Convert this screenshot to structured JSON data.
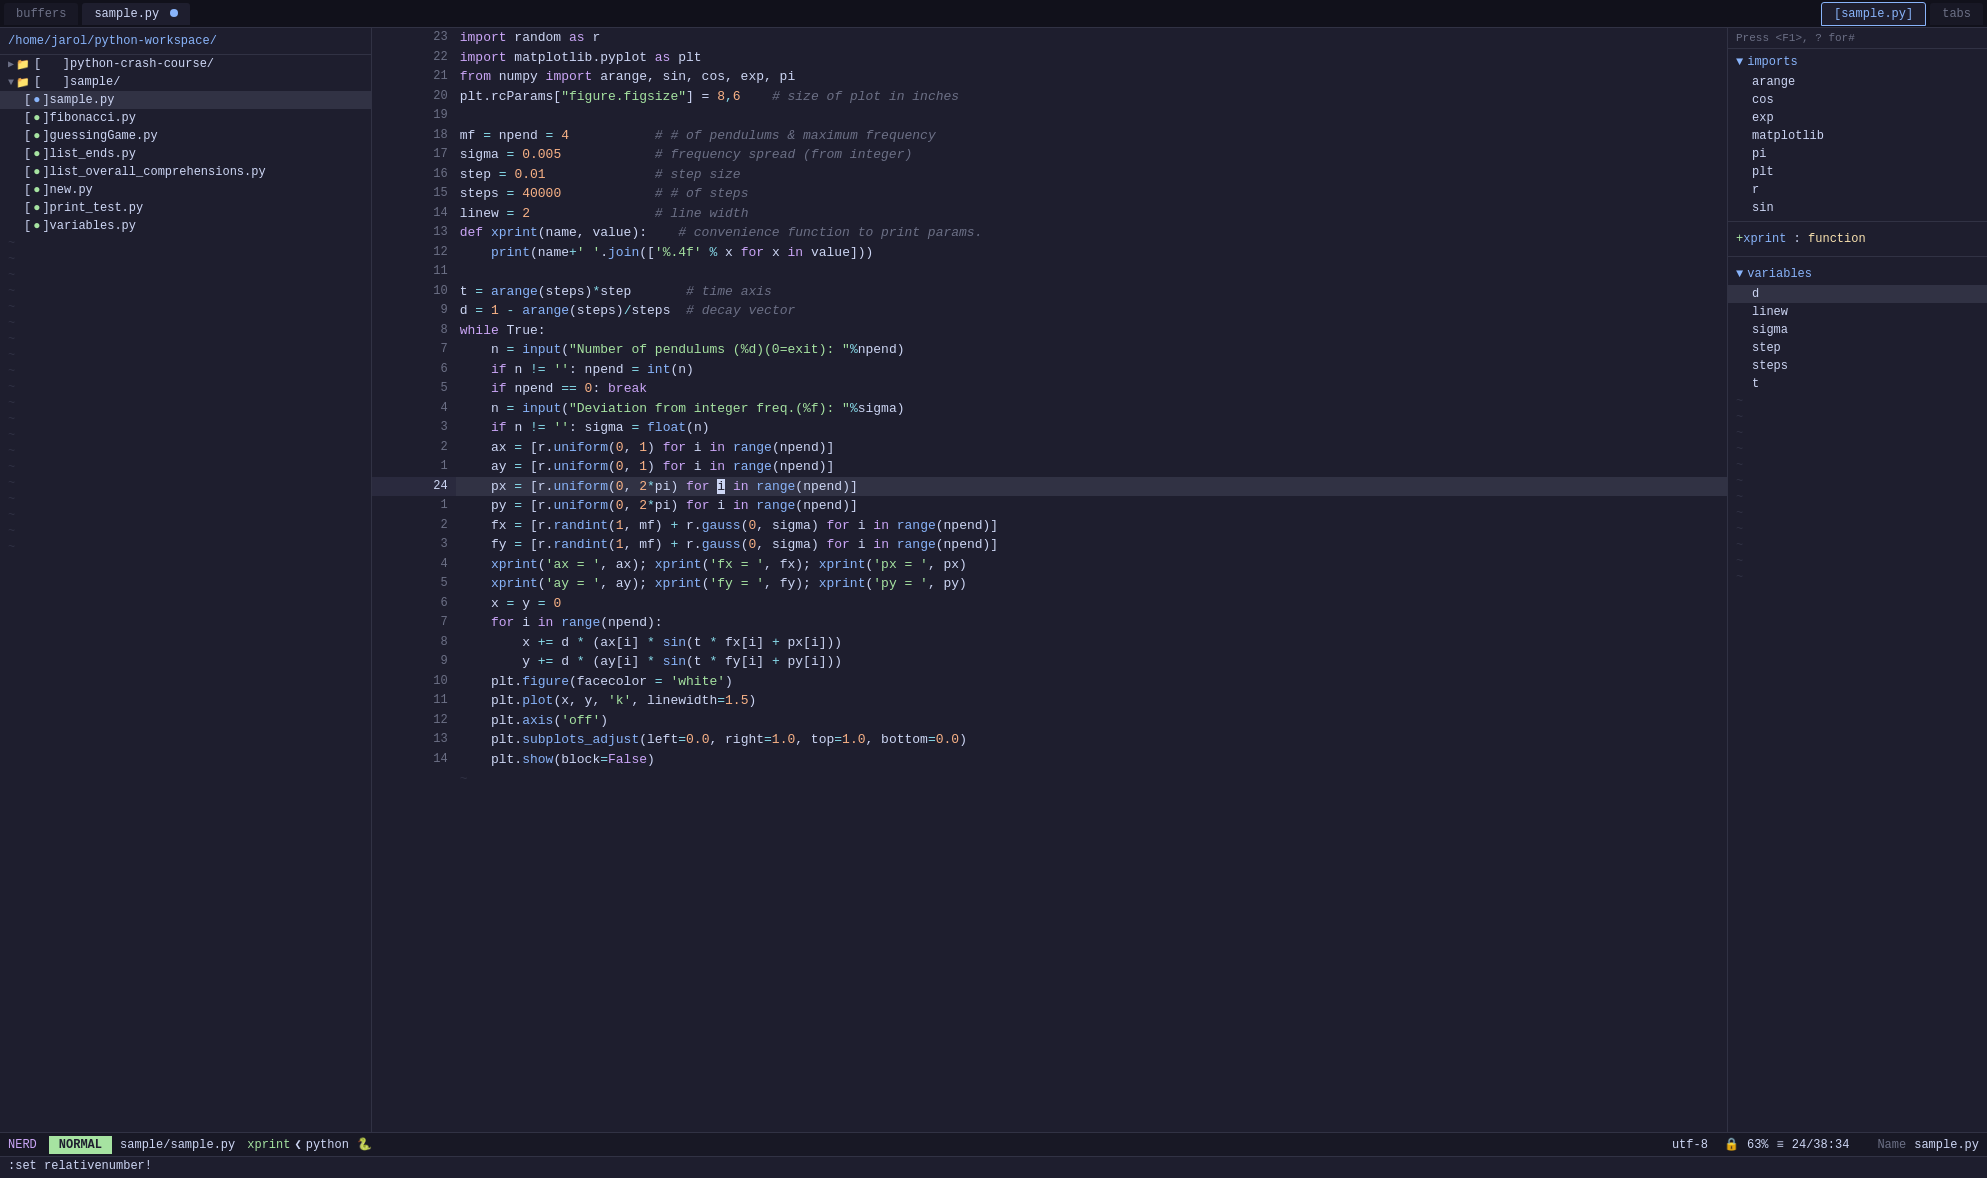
{
  "tabs": {
    "items": [
      {
        "label": "buffers",
        "active": false
      },
      {
        "label": "sample.py",
        "active": true,
        "has_dot": true
      },
      {
        "label": "tabs",
        "active": false,
        "right": true
      }
    ]
  },
  "sidebar": {
    "path": "/home/jarol/python-workspace/",
    "items": [
      {
        "indent": 0,
        "type": "chevron-open",
        "icon": "folder",
        "label": "]python-crash-course/",
        "active": false
      },
      {
        "indent": 0,
        "type": "chevron-open",
        "icon": "folder",
        "label": "]sample/",
        "active": false
      },
      {
        "indent": 1,
        "type": "file",
        "icon": "py",
        "label": "]sample.py",
        "active": true
      },
      {
        "indent": 1,
        "type": "file",
        "icon": "py",
        "label": "]fibonacci.py",
        "active": false
      },
      {
        "indent": 1,
        "type": "file",
        "icon": "py",
        "label": "]guessingGame.py",
        "active": false
      },
      {
        "indent": 1,
        "type": "file",
        "icon": "py",
        "label": "]list_ends.py",
        "active": false
      },
      {
        "indent": 1,
        "type": "file",
        "icon": "py",
        "label": "]list_overall_comprehensions.py",
        "active": false
      },
      {
        "indent": 1,
        "type": "file",
        "icon": "py",
        "label": "]new.py",
        "active": false
      },
      {
        "indent": 1,
        "type": "file",
        "icon": "py",
        "label": "]print_test.py",
        "active": false
      },
      {
        "indent": 1,
        "type": "file",
        "icon": "py",
        "label": "]variables.py",
        "active": false
      }
    ]
  },
  "editor": {
    "filename": "sample.py",
    "lines": [
      {
        "num": "23",
        "rel": "1",
        "content": "import random as r",
        "tokens": [
          {
            "t": "kw",
            "v": "import"
          },
          {
            "t": "id",
            "v": " random "
          },
          {
            "t": "kw",
            "v": "as"
          },
          {
            "t": "id",
            "v": " r"
          }
        ]
      },
      {
        "num": "22",
        "rel": "2",
        "content": "import matplotlib.pyplot as plt",
        "tokens": [
          {
            "t": "kw",
            "v": "import"
          },
          {
            "t": "id",
            "v": " matplotlib.pyplot "
          },
          {
            "t": "kw",
            "v": "as"
          },
          {
            "t": "id",
            "v": " plt"
          }
        ]
      },
      {
        "num": "21",
        "rel": "3",
        "content": "from numpy import arange, sin, cos, exp, pi",
        "tokens": [
          {
            "t": "kw",
            "v": "from"
          },
          {
            "t": "id",
            "v": " numpy "
          },
          {
            "t": "kw",
            "v": "import"
          },
          {
            "t": "id",
            "v": " arange, sin, cos, exp, pi"
          }
        ]
      },
      {
        "num": "20",
        "rel": "4",
        "content": "plt.rcParams[\"figure.figsize\"] = 8,6    # size of plot in inches"
      },
      {
        "num": "19",
        "rel": "5",
        "content": ""
      },
      {
        "num": "18",
        "rel": "6",
        "content": "mf = npend = 4           # # of pendulums & maximum frequency"
      },
      {
        "num": "17",
        "rel": "7",
        "content": "sigma = 0.005            # frequency spread (from integer)"
      },
      {
        "num": "16",
        "rel": "8",
        "content": "step = 0.01              # step size"
      },
      {
        "num": "15",
        "rel": "9",
        "content": "steps = 40000            # # of steps"
      },
      {
        "num": "14",
        "rel": "10",
        "content": "linew = 2                # line width"
      },
      {
        "num": "13",
        "rel": "11",
        "content": "def xprint(name, value):    # convenience function to print params."
      },
      {
        "num": "12",
        "rel": "12",
        "content": "    print(name+' '.join(['%.4f' % x for x in value]))"
      },
      {
        "num": "11",
        "rel": "13",
        "content": ""
      },
      {
        "num": "10",
        "rel": "14",
        "content": "t = arange(steps)*step       # time axis"
      },
      {
        "num": "9",
        "rel": "15",
        "content": "d = 1 - arange(steps)/steps  # decay vector"
      },
      {
        "num": "8",
        "rel": "16",
        "content": "while True:"
      },
      {
        "num": "7",
        "rel": "17",
        "content": "    n = input(\"Number of pendulums (%d)(0=exit): \"%npend)"
      },
      {
        "num": "6",
        "rel": "18",
        "content": "    if n != '': npend = int(n)"
      },
      {
        "num": "5",
        "rel": "19",
        "content": "    if npend == 0: break"
      },
      {
        "num": "4",
        "rel": "20",
        "content": "    n = input(\"Deviation from integer freq.(%f): \"%sigma)"
      },
      {
        "num": "3",
        "rel": "21",
        "content": "    if n != '': sigma = float(n)"
      },
      {
        "num": "2",
        "rel": "22",
        "content": "    ax = [r.uniform(0, 1) for i in range(npend)]"
      },
      {
        "num": "1",
        "rel": "23",
        "content": "    ay = [r.uniform(0, 1) for i in range(npend)]"
      },
      {
        "num": "24",
        "rel": "0",
        "content": "    px = [r.uniform(0, 2*pi) for i in range(npend)]",
        "current": true
      },
      {
        "num": "1",
        "rel": "1",
        "content": "    py = [r.uniform(0, 2*pi) for i in range(npend)]"
      },
      {
        "num": "2",
        "rel": "2",
        "content": "    fx = [r.randint(1, mf) + r.gauss(0, sigma) for i in range(npend)]"
      },
      {
        "num": "3",
        "rel": "3",
        "content": "    fy = [r.randint(1, mf) + r.gauss(0, sigma) for i in range(npend)]"
      },
      {
        "num": "4",
        "rel": "4",
        "content": "    xprint('ax = ', ax); xprint('fx = ', fx); xprint('px = ', px)"
      },
      {
        "num": "5",
        "rel": "5",
        "content": "    xprint('ay = ', ay); xprint('fy = ', fy); xprint('py = ', py)"
      },
      {
        "num": "6",
        "rel": "6",
        "content": "    x = y = 0"
      },
      {
        "num": "7",
        "rel": "7",
        "content": "    for i in range(npend):"
      },
      {
        "num": "8",
        "rel": "8",
        "content": "        x += d * (ax[i] * sin(t * fx[i] + px[i]))"
      },
      {
        "num": "9",
        "rel": "9",
        "content": "        y += d * (ay[i] * sin(t * fy[i] + py[i]))"
      },
      {
        "num": "10",
        "rel": "10",
        "content": "    plt.figure(facecolor = 'white')"
      },
      {
        "num": "11",
        "rel": "11",
        "content": "    plt.plot(x, y, 'k', linewidth=1.5)"
      },
      {
        "num": "12",
        "rel": "12",
        "content": "    plt.axis('off')"
      },
      {
        "num": "13",
        "rel": "13",
        "content": "    plt.subplots_adjust(left=0.0, right=1.0, top=1.0, bottom=0.0)"
      },
      {
        "num": "14",
        "rel": "14",
        "content": "    plt.show(block=False)"
      }
    ]
  },
  "right_panel": {
    "tab_sample": "[sample.py]",
    "tab_tabs": "tabs",
    "hint": "Press <F1>, ? for#",
    "imports_section": "imports",
    "imports": [
      "arange",
      "cos",
      "exp",
      "matplotlib",
      "pi",
      "plt",
      "r",
      "sin"
    ],
    "xprint_label": "+xprint : function",
    "variables_section": "variables",
    "variables": [
      "d",
      "linew",
      "sigma",
      "step",
      "steps",
      "t"
    ],
    "highlighted_var": "d"
  },
  "statusbar": {
    "nerd": "NERD",
    "mode": "NORMAL",
    "file": "sample/sample.py",
    "fn": "xprint",
    "arrow": "❮",
    "lang": "python",
    "encoding": "utf-8",
    "lock": "🔒",
    "percent": "63%",
    "progress_icon": "≡",
    "position": "24/38",
    "separator": ":",
    "col": "34",
    "right_label": "Name",
    "right_file": "sample.py"
  },
  "cmdline": {
    "text": ":set relativenumber!"
  }
}
